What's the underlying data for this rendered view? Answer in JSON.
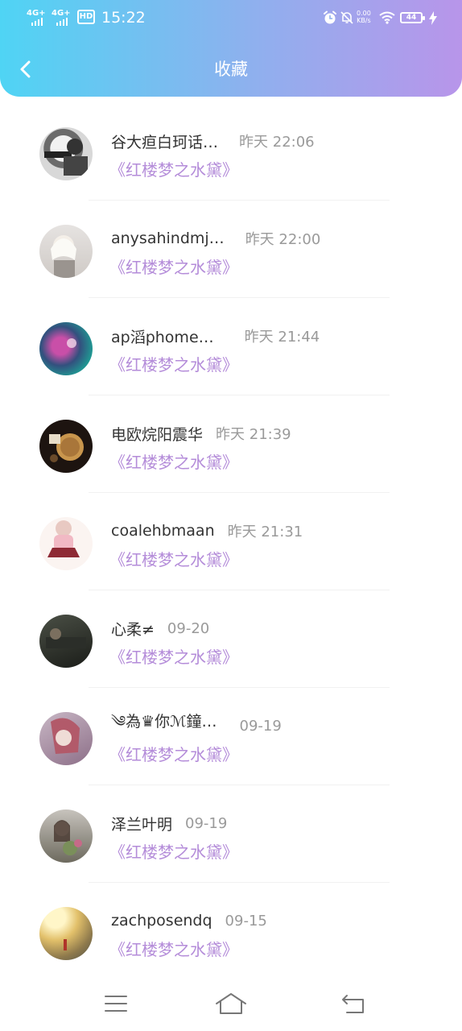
{
  "status_bar": {
    "signal1": "4G+",
    "signal2": "4G+",
    "hd": "HD",
    "time": "15:22",
    "net_speed_value": "0.00",
    "net_speed_unit": "KB/s",
    "battery": "44"
  },
  "header": {
    "title": "收藏",
    "accent_start": "#4fd4f4",
    "accent_end": "#b895ea"
  },
  "items": [
    {
      "name": "谷大疸白珂话…",
      "time": "昨天 22:06",
      "work": "《红楼梦之水黛》"
    },
    {
      "name": "anysahindmj…",
      "time": "昨天 22:00",
      "work": "《红楼梦之水黛》"
    },
    {
      "name": "ap滔phome…",
      "time": "昨天 21:44",
      "work": "《红楼梦之水黛》"
    },
    {
      "name": "电欧烷阳震华",
      "time": "昨天 21:39",
      "work": "《红楼梦之水黛》"
    },
    {
      "name": "coalehbmaan",
      "time": "昨天 21:31",
      "work": "《红楼梦之水黛》"
    },
    {
      "name": "心柔≠",
      "time": "09-20",
      "work": "《红楼梦之水黛》"
    },
    {
      "name": "༄為♛你ℳ鐘…",
      "time": "09-19",
      "work": "《红楼梦之水黛》"
    },
    {
      "name": "泽兰叶明",
      "time": "09-19",
      "work": "《红楼梦之水黛》"
    },
    {
      "name": "zachposendq",
      "time": "09-15",
      "work": "《红楼梦之水黛》"
    }
  ],
  "colors": {
    "work_title": "#b48cd9",
    "name": "#333333",
    "time": "#9a9a9a"
  },
  "icons": {
    "back": "chevron-left-icon",
    "menu": "menu-icon",
    "home": "home-icon",
    "return": "return-icon"
  }
}
